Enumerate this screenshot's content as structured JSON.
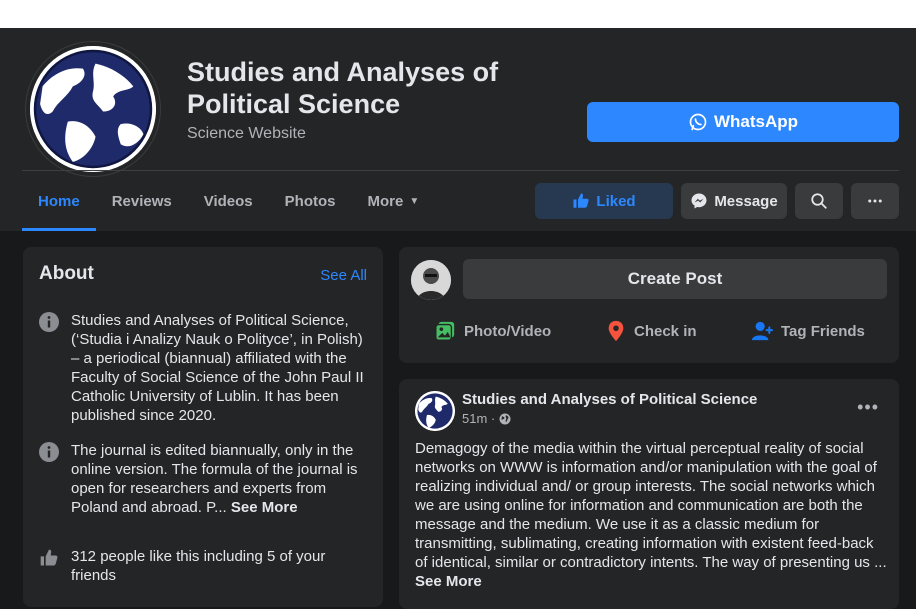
{
  "page": {
    "title": "Studies and Analyses of Political Science",
    "category": "Science Website",
    "whatsapp_label": "WhatsApp"
  },
  "nav": {
    "tabs": [
      {
        "label": "Home",
        "active": true
      },
      {
        "label": "Reviews",
        "active": false
      },
      {
        "label": "Videos",
        "active": false
      },
      {
        "label": "Photos",
        "active": false
      },
      {
        "label": "More",
        "active": false
      }
    ]
  },
  "actions": {
    "liked_label": "Liked",
    "message_label": "Message",
    "search_icon": "search-icon",
    "more_icon": "more-dots-icon"
  },
  "about": {
    "title": "About",
    "see_all": "See All",
    "description": "Studies and Analyses of Political Science, (‘Studia i Analizy Nauk o Polityce’, in Polish) – a periodical (biannual) affiliated with the Faculty of Social Science of the John Paul II Catholic University of Lublin. It has been published since 2020.",
    "note": "The journal is edited biannually, only in the online version. The formula of the journal is open for researchers and experts from Poland and abroad. P...",
    "note_see_more": "See More",
    "likes": "312 people like this including 5 of your friends"
  },
  "composer": {
    "create_post": "Create Post",
    "photo_video": "Photo/Video",
    "check_in": "Check in",
    "tag_friends": "Tag Friends"
  },
  "post": {
    "author": "Studies and Analyses of Political Science",
    "time": "51m ·",
    "body": "Demagogy of the media within the virtual perceptual reality of social networks on WWW is information and/or manipulation with the goal of realizing individual and/ or group interests. The social networks which we are using online for information and communication are both the message and the medium. We use it as a classic medium for transmitting, sublimating, creating information with existent feed-back of identical, similar or contradictory intents. The way of presenting us ...",
    "see_more": "See More"
  },
  "colors": {
    "accent": "#2d88ff",
    "background": "#18191a",
    "card": "#242526",
    "button": "#3a3b3c"
  }
}
